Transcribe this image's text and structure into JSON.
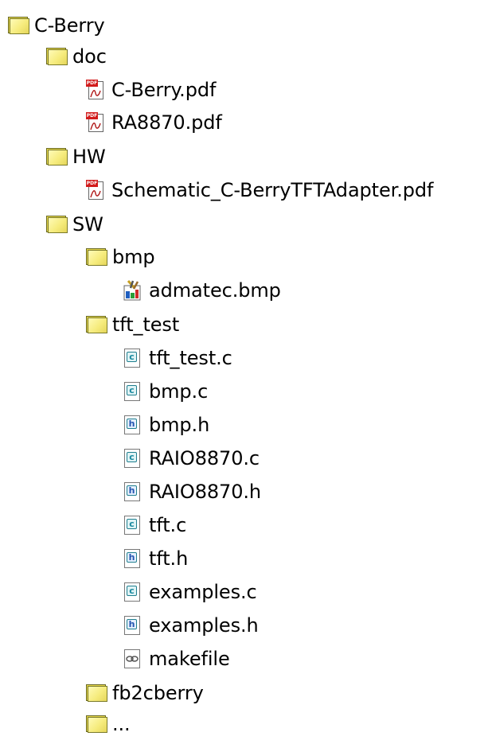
{
  "tree": {
    "root": {
      "label": "C-Berry",
      "doc": {
        "label": "doc",
        "files": [
          "C-Berry.pdf",
          "RA8870.pdf"
        ]
      },
      "hw": {
        "label": "HW",
        "files": [
          "Schematic_C-BerryTFTAdapter.pdf"
        ]
      },
      "sw": {
        "label": "SW",
        "bmp": {
          "label": "bmp",
          "files": [
            "admatec.bmp"
          ]
        },
        "tft_test": {
          "label": "tft_test",
          "files": [
            "tft_test.c",
            "bmp.c",
            "bmp.h",
            "RAIO8870.c",
            "RAIO8870.h",
            "tft.c",
            "tft.h",
            "examples.c",
            "examples.h",
            "makefile"
          ]
        },
        "fb2cberry": {
          "label": "fb2cberry"
        },
        "more": {
          "label": "..."
        }
      }
    }
  },
  "icons": {
    "folder": "folder-icon",
    "pdf": "pdf-file-icon",
    "bmp": "bitmap-file-icon",
    "c": "c-source-file-icon",
    "h": "header-file-icon",
    "makefile": "makefile-icon"
  },
  "colors": {
    "folder_fill": "#f6ec7e",
    "folder_border": "#7a7a2a",
    "pdf_badge": "#d21c1c",
    "c_badge": "#1a8aa0",
    "h_badge": "#2455b0"
  }
}
